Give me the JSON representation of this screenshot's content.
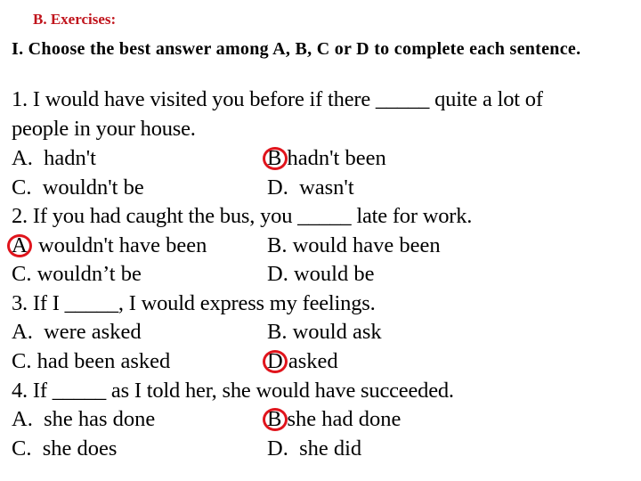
{
  "header": {
    "section_title": "B. Exercises:",
    "instruction": "I. Choose the best answer among A, B, C or D to complete each sentence."
  },
  "accent_color": "#e0141c",
  "questions": [
    {
      "number": "1.",
      "text_line1": "1. I would have visited you before if there _____ quite a lot of",
      "text_line2": "people in your house.",
      "options": [
        {
          "letter": "A.",
          "text": "  hadn't",
          "selected": false
        },
        {
          "letter": "B.",
          "text": " hadn't been",
          "selected": true
        },
        {
          "letter": "C.",
          "text": "  wouldn't be",
          "selected": false
        },
        {
          "letter": "D.",
          "text": "  wasn't",
          "selected": false
        }
      ]
    },
    {
      "number": "2.",
      "text_line1": "2. If you had caught the bus, you _____ late for work.",
      "options": [
        {
          "letter": "A.",
          "text": "  wouldn't have been",
          "selected": true
        },
        {
          "letter": "B.",
          "text": " would have been",
          "selected": false
        },
        {
          "letter": "C.",
          "text": " wouldn’t be",
          "selected": false
        },
        {
          "letter": "D.",
          "text": " would be",
          "selected": false
        }
      ]
    },
    {
      "number": "3.",
      "text_line1": "3. If I _____, I would express my feelings.",
      "options": [
        {
          "letter": "A.",
          "text": "  were asked",
          "selected": false
        },
        {
          "letter": "B.",
          "text": " would ask",
          "selected": false
        },
        {
          "letter": "C.",
          "text": " had been asked",
          "selected": false
        },
        {
          "letter": "D.",
          "text": " asked",
          "selected": true
        }
      ]
    },
    {
      "number": "4.",
      "text_line1": "4. If _____ as I told her, she would have succeeded.",
      "options": [
        {
          "letter": "A.",
          "text": "  she has done",
          "selected": false
        },
        {
          "letter": "B.",
          "text": " she had done",
          "selected": true
        },
        {
          "letter": "C.",
          "text": "  she does",
          "selected": false
        },
        {
          "letter": "D.",
          "text": "  she did",
          "selected": false
        }
      ]
    }
  ]
}
